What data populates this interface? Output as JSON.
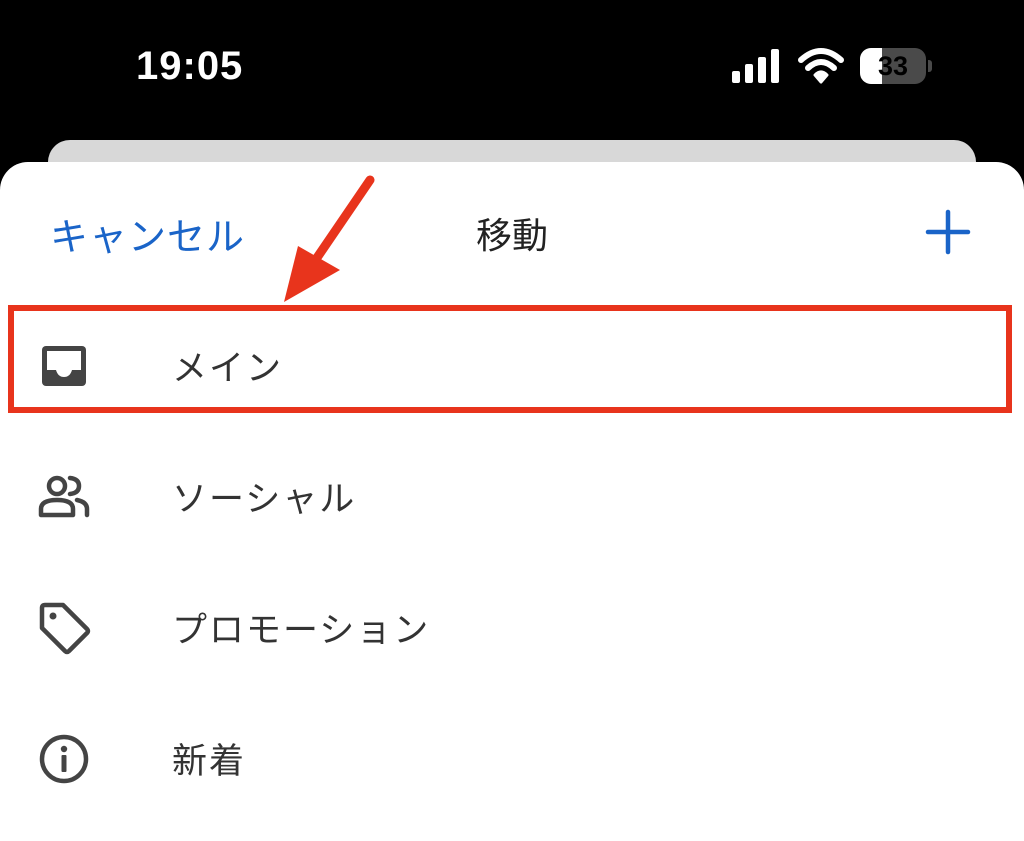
{
  "status_bar": {
    "time": "19:05",
    "battery_label": "33",
    "battery_level_percent": 33,
    "icons": [
      "signal-icon",
      "wifi-icon",
      "battery-icon"
    ]
  },
  "sheet": {
    "cancel_label": "キャンセル",
    "title": "移動",
    "add_icon": "plus-icon"
  },
  "items": [
    {
      "label": "メイン",
      "icon": "inbox-icon"
    },
    {
      "label": "ソーシャル",
      "icon": "people-icon"
    },
    {
      "label": "プロモーション",
      "icon": "tag-icon"
    },
    {
      "label": "新着",
      "icon": "info-icon"
    }
  ],
  "colors": {
    "accent": "#1a64c8",
    "annotation": "#e8341c",
    "icon": "#444444"
  }
}
